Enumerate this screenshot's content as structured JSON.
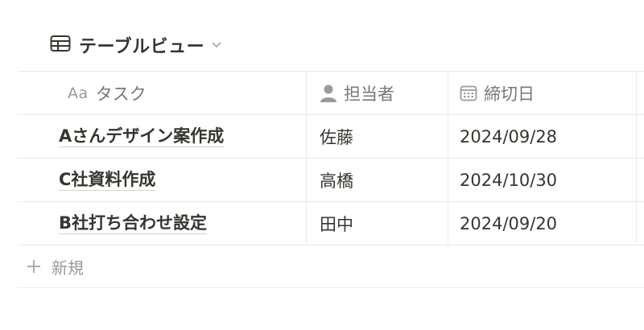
{
  "view": {
    "title": "テーブルビュー",
    "icon": "table-icon"
  },
  "columns": [
    {
      "label": "タスク",
      "prefix": "Aa",
      "icon": "text-type-icon"
    },
    {
      "label": "担当者",
      "icon": "person-icon"
    },
    {
      "label": "締切日",
      "icon": "calendar-icon"
    }
  ],
  "rows": [
    {
      "task": "Aさんデザイン案作成",
      "assignee": "佐藤",
      "due": "2024/09/28"
    },
    {
      "task": "C社資料作成",
      "assignee": "高橋",
      "due": "2024/10/30"
    },
    {
      "task": "B社打ち合わせ設定",
      "assignee": "田中",
      "due": "2024/09/20"
    }
  ],
  "new_row": {
    "label": "新規",
    "icon": "plus-icon"
  },
  "colors": {
    "text": "#37352f",
    "muted": "#9b9a97",
    "border": "#e9e9e7"
  }
}
